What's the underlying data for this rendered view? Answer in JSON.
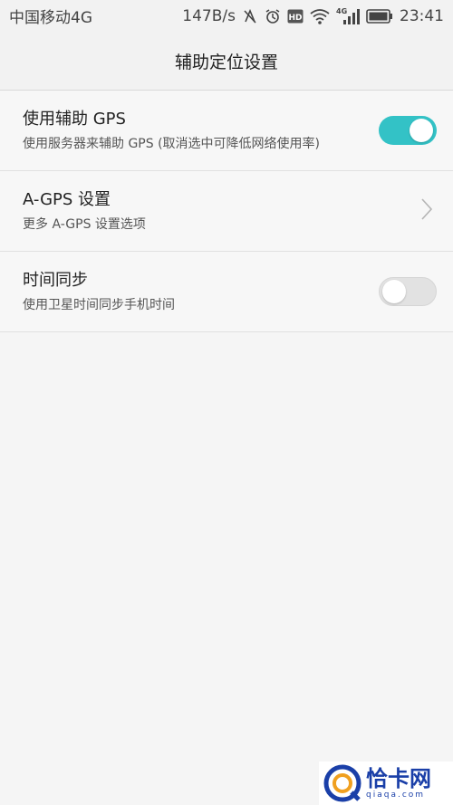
{
  "status_bar": {
    "carrier": "中国移动4G",
    "speed": "147B/s",
    "network_badge": "4G",
    "time": "23:41"
  },
  "header": {
    "title": "辅助定位设置"
  },
  "settings": [
    {
      "title": "使用辅助 GPS",
      "subtitle": "使用服务器来辅助 GPS (取消选中可降低网络使用率)",
      "control": "toggle",
      "enabled": true
    },
    {
      "title": "A-GPS 设置",
      "subtitle": "更多 A-GPS 设置选项",
      "control": "chevron-right-icon"
    },
    {
      "title": "时间同步",
      "subtitle": "使用卫星时间同步手机时间",
      "control": "toggle",
      "enabled": false
    }
  ],
  "watermark": {
    "name": "恰卡网",
    "domain": "qiaqa.com"
  },
  "colors": {
    "accent": "#33c2c6",
    "watermark": "#1a3fa8"
  }
}
